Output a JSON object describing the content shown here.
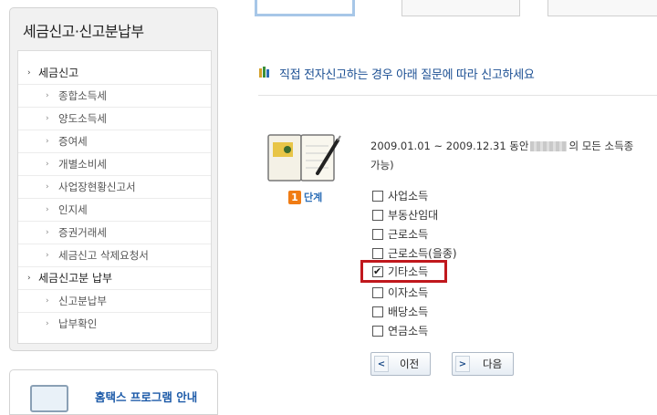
{
  "sidebar": {
    "title": "세금신고·신고분납부",
    "items": [
      {
        "label": "세금신고",
        "level": "cat"
      },
      {
        "label": "종합소득세",
        "level": "sub"
      },
      {
        "label": "양도소득세",
        "level": "sub"
      },
      {
        "label": "증여세",
        "level": "sub"
      },
      {
        "label": "개별소비세",
        "level": "sub"
      },
      {
        "label": "사업장현황신고서",
        "level": "sub"
      },
      {
        "label": "인지세",
        "level": "sub"
      },
      {
        "label": "증권거래세",
        "level": "sub"
      },
      {
        "label": "세금신고 삭제요청서",
        "level": "sub"
      },
      {
        "label": "세금신고분 납부",
        "level": "cat"
      },
      {
        "label": "신고분납부",
        "level": "sub"
      },
      {
        "label": "납부확인",
        "level": "sub"
      }
    ]
  },
  "promo": {
    "label": "홈택스 프로그램 안내"
  },
  "main": {
    "heading": "직접 전자신고하는 경우 아래 질문에 따라 신고하세요",
    "step": {
      "number": "1",
      "label": "단계"
    },
    "question": {
      "line1_prefix": "2009.01.01 ~ 2009.12.31 동안",
      "line1_suffix": "의 모든 소득종",
      "line2": "가능)"
    },
    "options": [
      {
        "label": "사업소득",
        "checked": false
      },
      {
        "label": "부동산임대",
        "checked": false
      },
      {
        "label": "근로소득",
        "checked": false
      },
      {
        "label": "근로소득(을종)",
        "checked": false
      },
      {
        "label": "기타소득",
        "checked": true
      },
      {
        "label": "이자소득",
        "checked": false
      },
      {
        "label": "배당소득",
        "checked": false
      },
      {
        "label": "연금소득",
        "checked": false
      }
    ],
    "buttons": {
      "prev": {
        "label": "이전",
        "arrow": "<"
      },
      "next": {
        "label": "다음",
        "arrow": ">"
      }
    }
  },
  "colors": {
    "heading": "#1b4f93",
    "highlight": "#c0181d",
    "step_badge": "#f07c14"
  }
}
